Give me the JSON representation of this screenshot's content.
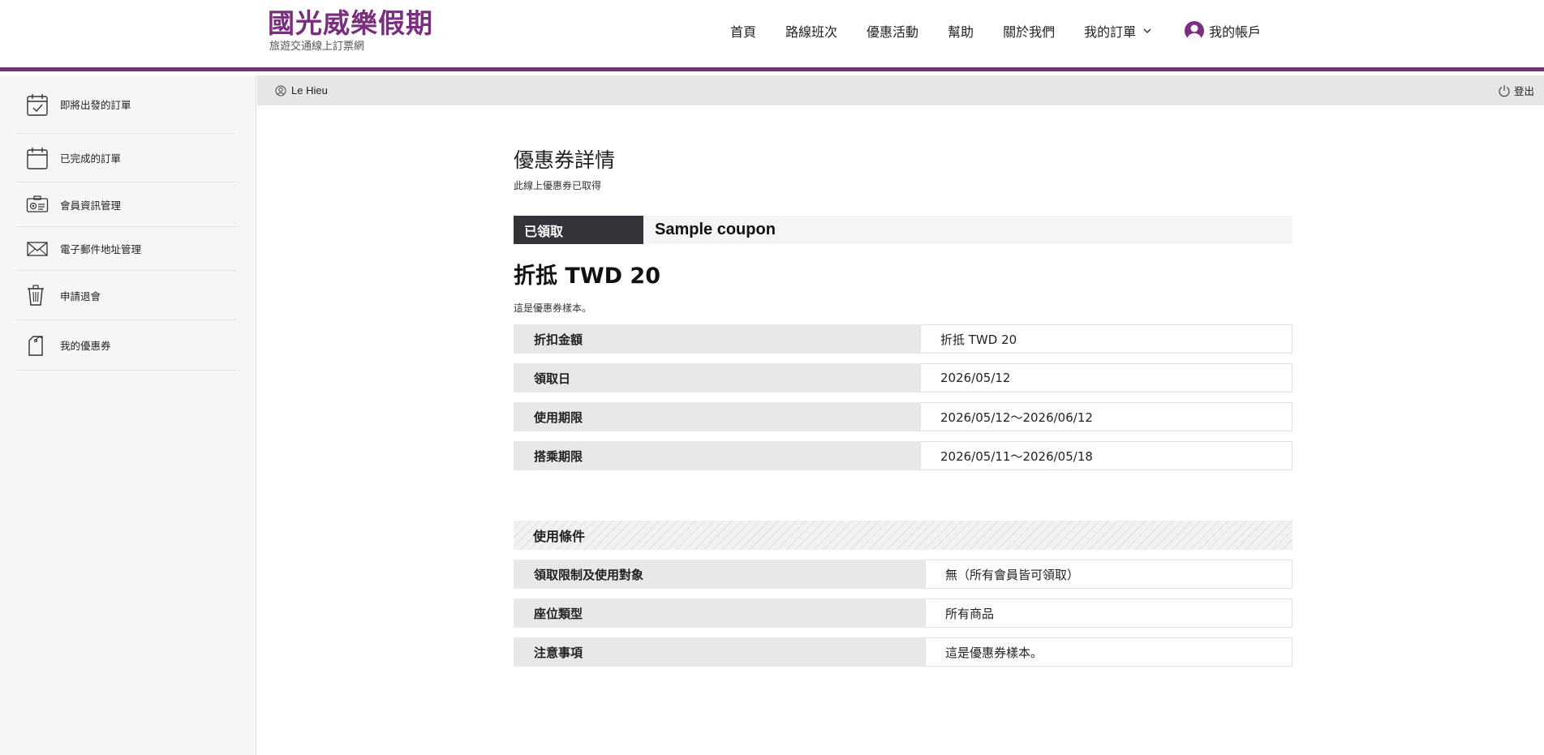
{
  "header": {
    "brand_title": "國光威樂假期",
    "brand_subtitle": "旅遊交通線上訂票網",
    "nav": [
      {
        "label": "首頁"
      },
      {
        "label": "路線班次"
      },
      {
        "label": "優惠活動"
      },
      {
        "label": "幫助"
      },
      {
        "label": "關於我們"
      },
      {
        "label": "我的訂單"
      }
    ],
    "account_label": "我的帳戶",
    "brand_color": "#7a2f7e"
  },
  "sidebar": {
    "items": [
      {
        "label": "即將出發的訂單",
        "icon": "calendar-check-icon"
      },
      {
        "label": "已完成的訂單",
        "icon": "calendar-icon"
      },
      {
        "label": "會員資訊管理",
        "icon": "id-card-icon"
      },
      {
        "label": "電子郵件地址管理",
        "icon": "envelope-icon"
      },
      {
        "label": "申請退會",
        "icon": "trash-icon"
      },
      {
        "label": "我的優惠券",
        "icon": "coupon-tag-icon"
      }
    ]
  },
  "userbar": {
    "username": "Le Hieu",
    "logout_label": "登出"
  },
  "main": {
    "title": "優惠券詳情",
    "subtitle": "此線上優惠券已取得",
    "status_badge": "已領取",
    "coupon_name": "Sample coupon",
    "discount_title": "折抵 TWD 20",
    "description": "這是優惠券樣本。",
    "details": [
      {
        "label": "折扣金額",
        "value": "折抵 TWD 20"
      },
      {
        "label": "領取日",
        "value": "2026/05/12"
      },
      {
        "label": "使用期限",
        "value": "2026/05/12～2026/06/12"
      },
      {
        "label": "搭乘期限",
        "value": "2026/05/11～2026/05/18"
      }
    ],
    "conditions_title": "使用條件",
    "conditions": [
      {
        "label": "領取限制及使用對象",
        "value": "無（所有會員皆可領取）"
      },
      {
        "label": "座位類型",
        "value": "所有商品"
      },
      {
        "label": "注意事項",
        "value": "這是優惠券樣本。"
      }
    ]
  }
}
